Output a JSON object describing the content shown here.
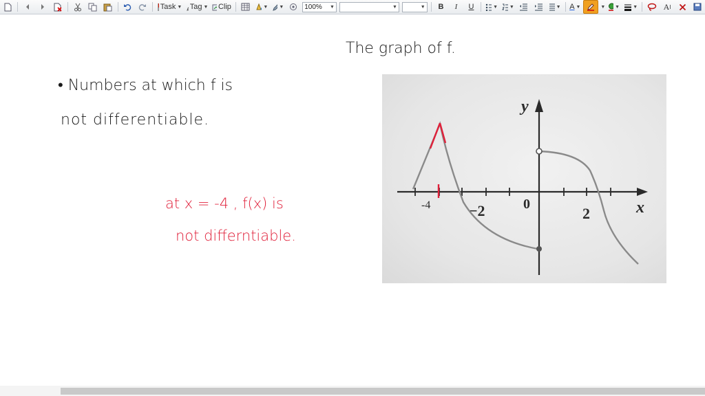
{
  "toolbar": {
    "task_label": "Task",
    "tag_label": "Tag",
    "clip_label": "Clip",
    "zoom_value": "100%",
    "font_value": "",
    "size_value": "",
    "bold_label": "B",
    "italic_label": "I",
    "underline_label": "U",
    "font_color_label": "A",
    "text_size_label": "A",
    "accent_highlight": "#f0a020",
    "accent_pen": "#d01010"
  },
  "page": {
    "graph_caption": "The graph of f.",
    "question_line1": "• Numbers at which f is",
    "question_line2": "not differentiable.",
    "answer_line1": "at x = -4 , f(x) is",
    "answer_line2": "not differntiable.",
    "answer_color": "#e0203a"
  },
  "figure": {
    "y_label": "y",
    "x_label": "x",
    "ticks": [
      {
        "label": "-4"
      },
      {
        "label": "−2"
      },
      {
        "label": "0"
      },
      {
        "label": "2"
      }
    ]
  }
}
